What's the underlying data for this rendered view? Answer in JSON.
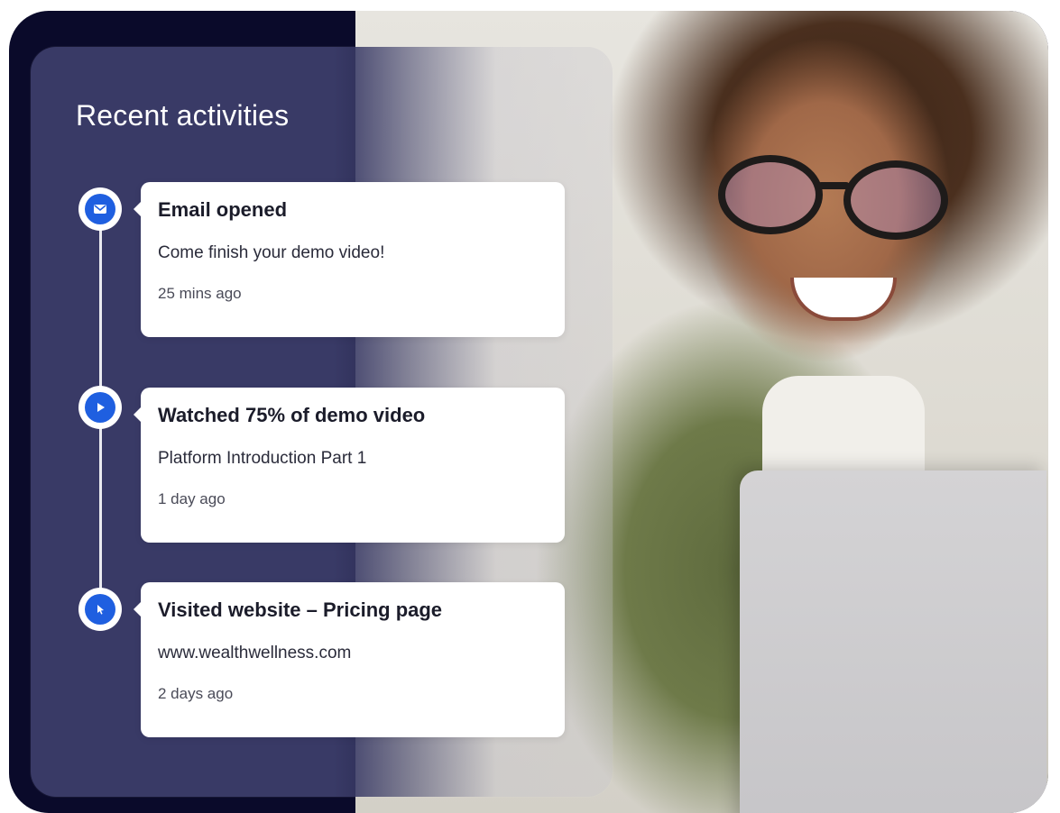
{
  "panel": {
    "title": "Recent activities"
  },
  "activities": [
    {
      "icon": "envelope-icon",
      "title": "Email opened",
      "subtitle": "Come finish your demo video!",
      "time": "25 mins ago"
    },
    {
      "icon": "play-icon",
      "title": "Watched 75% of demo video",
      "subtitle": "Platform Introduction Part 1",
      "time": "1 day ago"
    },
    {
      "icon": "cursor-icon",
      "title": "Visited website – Pricing page",
      "subtitle": "www.wealthwellness.com",
      "time": "2 days ago"
    }
  ],
  "colors": {
    "panel": "#393a66",
    "accent": "#1f5fe0",
    "frame": "#0a0a2a"
  }
}
